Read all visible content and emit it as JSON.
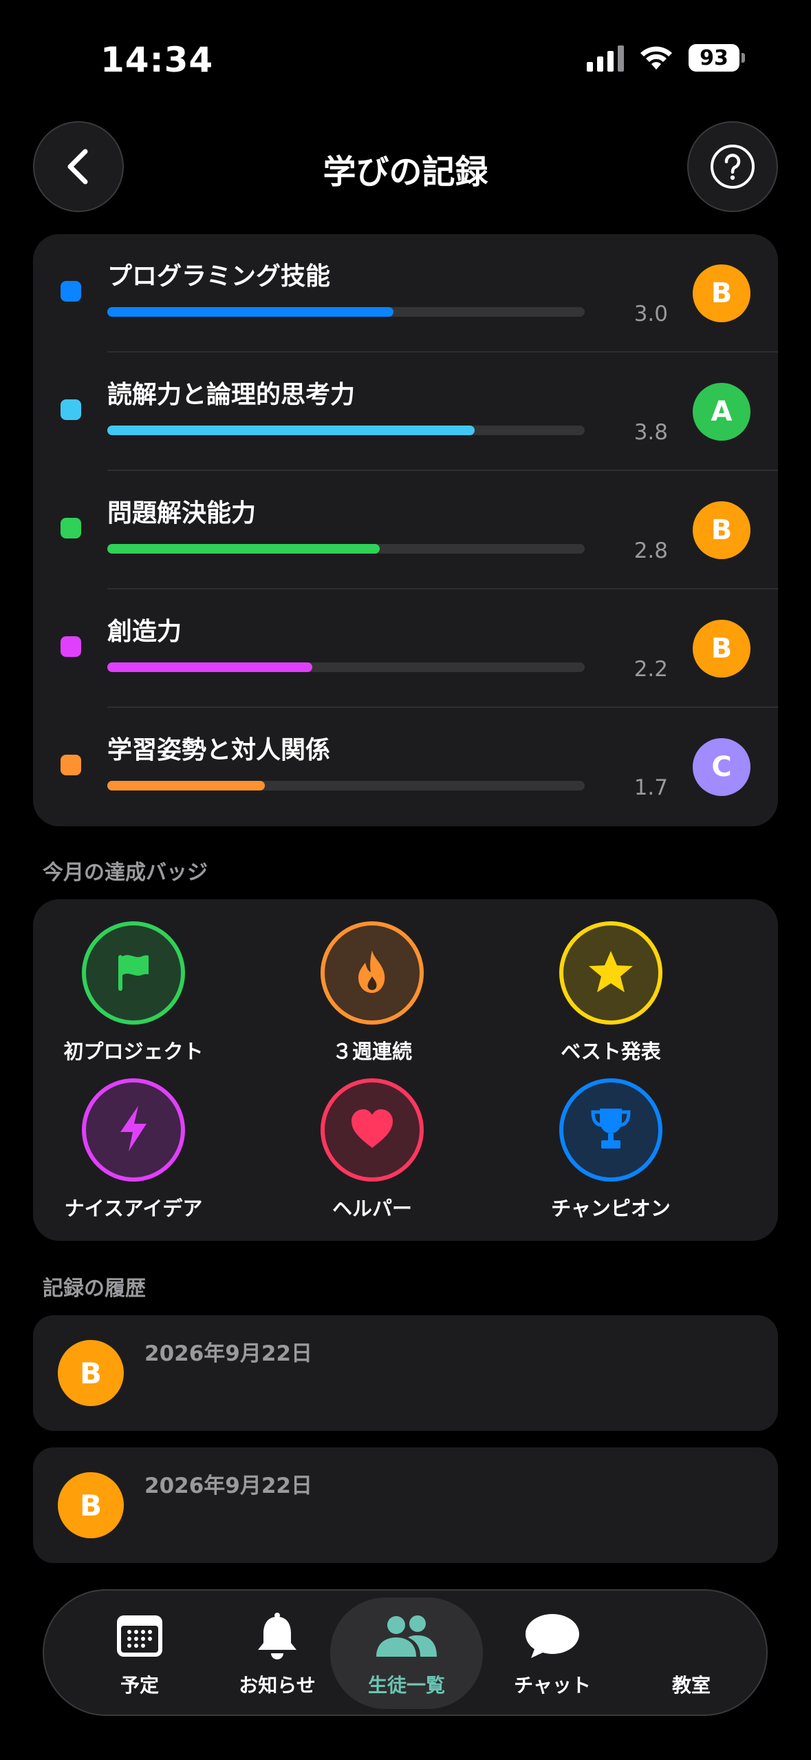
{
  "status": {
    "time": "14:34",
    "battery": "93"
  },
  "header": {
    "title": "学びの記録"
  },
  "skills": [
    {
      "name": "プログラミング技能",
      "value": "3.0",
      "grade": "B",
      "color": "#0a84ff",
      "progress": 0.6,
      "grade_color": "#ff9f0a"
    },
    {
      "name": "読解力と論理的思考力",
      "value": "3.8",
      "grade": "A",
      "color": "#40c8f5",
      "progress": 0.77,
      "grade_color": "#30c452"
    },
    {
      "name": "問題解決能力",
      "value": "2.8",
      "grade": "B",
      "color": "#30d158",
      "progress": 0.57,
      "grade_color": "#ff9f0a"
    },
    {
      "name": "創造力",
      "value": "2.2",
      "grade": "B",
      "color": "#e040fb",
      "progress": 0.43,
      "grade_color": "#ff9f0a"
    },
    {
      "name": "学習姿勢と対人関係",
      "value": "1.7",
      "grade": "C",
      "color": "#ff9230",
      "progress": 0.33,
      "grade_color": "#a08cff"
    }
  ],
  "badges_section": {
    "title": "今月の達成バッジ"
  },
  "badges": [
    {
      "label": "初プロジェクト",
      "icon": "flag-icon",
      "color": "#30d158"
    },
    {
      "label": "３週連続",
      "icon": "flame-icon",
      "color": "#ff9230"
    },
    {
      "label": "ベスト発表",
      "icon": "star-icon",
      "color": "#ffd60a"
    },
    {
      "label": "ナイスアイデア",
      "icon": "bolt-icon",
      "color": "#e040fb"
    },
    {
      "label": "ヘルパー",
      "icon": "heart-icon",
      "color": "#ff375f"
    },
    {
      "label": "チャンピオン",
      "icon": "trophy-icon",
      "color": "#0a84ff"
    }
  ],
  "history_section": {
    "title": "記録の履歴"
  },
  "history": [
    {
      "grade": "B",
      "date": "2026年9月22日"
    },
    {
      "grade": "B",
      "date": "2026年9月22日"
    }
  ],
  "tabbar": {
    "items": [
      {
        "label": "予定",
        "icon": "calendar-icon"
      },
      {
        "label": "お知らせ",
        "icon": "bell-icon"
      },
      {
        "label": "生徒一覧",
        "icon": "people-icon",
        "active": true
      },
      {
        "label": "チャット",
        "icon": "chat-bubble-icon"
      },
      {
        "label": "教室",
        "icon": ""
      }
    ]
  }
}
